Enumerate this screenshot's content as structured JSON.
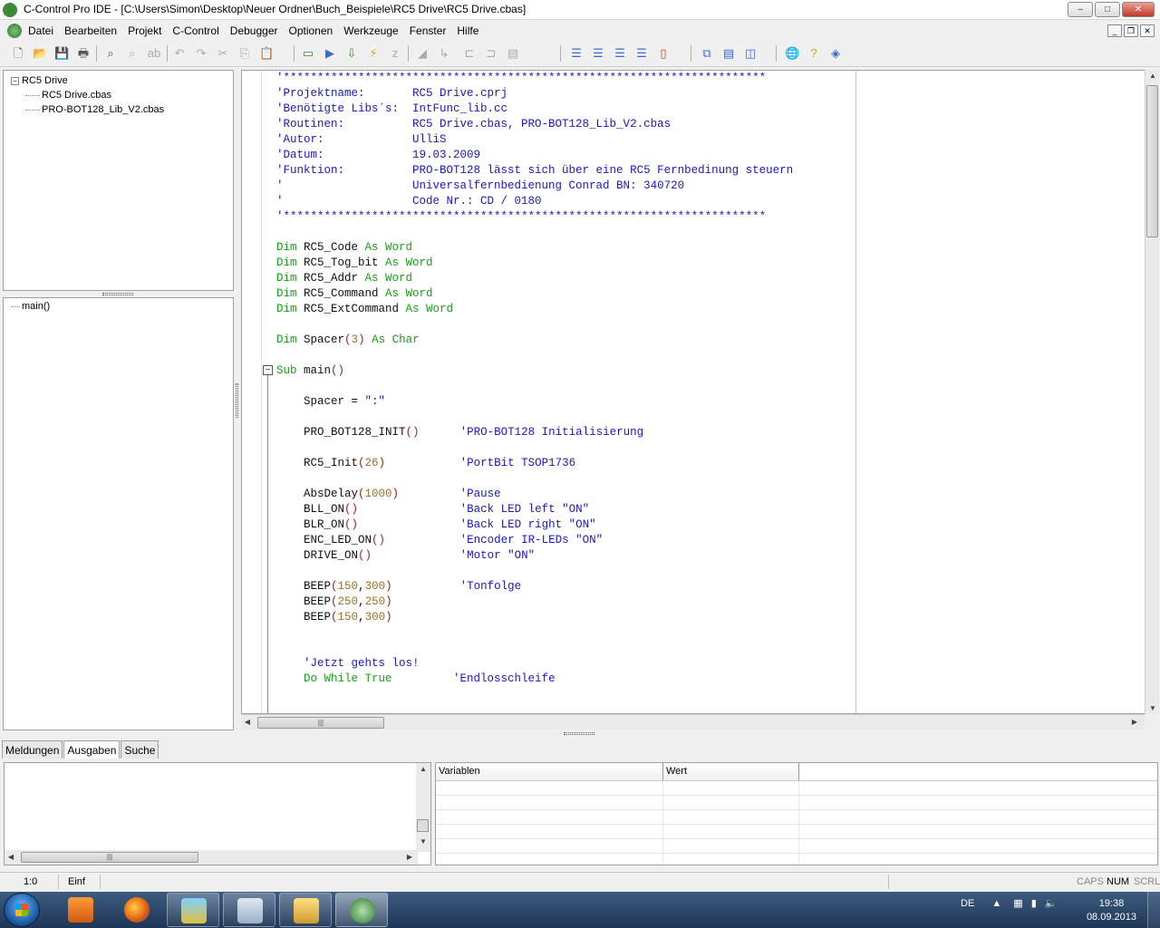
{
  "window": {
    "title": "C-Control Pro IDE - [C:\\Users\\Simon\\Desktop\\Neuer Ordner\\Buch_Beispiele\\RC5 Drive\\RC5 Drive.cbas]",
    "minimize": "–",
    "maximize": "□",
    "close": "✕"
  },
  "menu": {
    "items": [
      "Datei",
      "Bearbeiten",
      "Projekt",
      "C-Control",
      "Debugger",
      "Optionen",
      "Werkzeuge",
      "Fenster",
      "Hilfe"
    ],
    "mdi_minimize": "_",
    "mdi_restore": "❐",
    "mdi_close": "✕"
  },
  "project_tree": {
    "root": "RC5 Drive",
    "toggle": "−",
    "files": [
      "RC5 Drive.cbas",
      "PRO-BOT128_Lib_V2.cbas"
    ]
  },
  "functions": [
    "main()"
  ],
  "editor": {
    "lines": [
      [
        [
          "c-cm",
          "'***********************************************************************"
        ]
      ],
      [
        [
          "c-cm",
          "'Projektname:       RC5 Drive.cprj"
        ]
      ],
      [
        [
          "c-cm",
          "'Benötigte Libs´s:  IntFunc_lib.cc"
        ]
      ],
      [
        [
          "c-cm",
          "'Routinen:          RC5 Drive.cbas, PRO-BOT128_Lib_V2.cbas"
        ]
      ],
      [
        [
          "c-cm",
          "'Autor:             UlliS"
        ]
      ],
      [
        [
          "c-cm",
          "'Datum:             19.03.2009"
        ]
      ],
      [
        [
          "c-cm",
          "'Funktion:          PRO-BOT128 lässt sich über eine RC5 Fernbedinung steuern"
        ]
      ],
      [
        [
          "c-cm",
          "'                   Universalfernbedienung Conrad BN: 340720"
        ]
      ],
      [
        [
          "c-cm",
          "'                   Code Nr.: CD / 0180"
        ]
      ],
      [
        [
          "c-cm",
          "'***********************************************************************"
        ]
      ],
      [],
      [
        [
          "c-kw",
          "Dim "
        ],
        [
          "c-id",
          "RC5_Code "
        ],
        [
          "c-kw",
          "As Word"
        ]
      ],
      [
        [
          "c-kw",
          "Dim "
        ],
        [
          "c-id",
          "RC5_Tog_bit "
        ],
        [
          "c-kw",
          "As Word"
        ]
      ],
      [
        [
          "c-kw",
          "Dim "
        ],
        [
          "c-id",
          "RC5_Addr "
        ],
        [
          "c-kw",
          "As Word"
        ]
      ],
      [
        [
          "c-kw",
          "Dim "
        ],
        [
          "c-id",
          "RC5_Command "
        ],
        [
          "c-kw",
          "As Word"
        ]
      ],
      [
        [
          "c-kw",
          "Dim "
        ],
        [
          "c-id",
          "RC5_ExtCommand "
        ],
        [
          "c-kw",
          "As Word"
        ]
      ],
      [],
      [
        [
          "c-kw",
          "Dim "
        ],
        [
          "c-id",
          "Spacer"
        ],
        [
          "c-par",
          "("
        ],
        [
          "c-num",
          "3"
        ],
        [
          "c-par",
          ")"
        ],
        [
          "c-kw",
          " As Char"
        ]
      ],
      [],
      [
        [
          "c-kw",
          "Sub "
        ],
        [
          "c-id",
          "main"
        ],
        [
          "c-par",
          "()"
        ]
      ],
      [],
      [
        [
          "c-id",
          "    Spacer = "
        ],
        [
          "c-str",
          "\":\""
        ]
      ],
      [],
      [
        [
          "c-id",
          "    PRO_BOT128_INIT"
        ],
        [
          "c-par",
          "()"
        ],
        [
          "c-id",
          "      "
        ],
        [
          "c-cm",
          "'PRO-BOT128 Initialisierung"
        ]
      ],
      [],
      [
        [
          "c-id",
          "    RC5_Init"
        ],
        [
          "c-par",
          "("
        ],
        [
          "c-num",
          "26"
        ],
        [
          "c-par",
          ")"
        ],
        [
          "c-id",
          "           "
        ],
        [
          "c-cm",
          "'PortBit TSOP1736"
        ]
      ],
      [],
      [
        [
          "c-id",
          "    AbsDelay"
        ],
        [
          "c-par",
          "("
        ],
        [
          "c-num",
          "1000"
        ],
        [
          "c-par",
          ")"
        ],
        [
          "c-id",
          "         "
        ],
        [
          "c-cm",
          "'Pause"
        ]
      ],
      [
        [
          "c-id",
          "    BLL_ON"
        ],
        [
          "c-par",
          "()"
        ],
        [
          "c-id",
          "               "
        ],
        [
          "c-cm",
          "'Back LED left \"ON\""
        ]
      ],
      [
        [
          "c-id",
          "    BLR_ON"
        ],
        [
          "c-par",
          "()"
        ],
        [
          "c-id",
          "               "
        ],
        [
          "c-cm",
          "'Back LED right \"ON\""
        ]
      ],
      [
        [
          "c-id",
          "    ENC_LED_ON"
        ],
        [
          "c-par",
          "()"
        ],
        [
          "c-id",
          "           "
        ],
        [
          "c-cm",
          "'Encoder IR-LEDs \"ON\""
        ]
      ],
      [
        [
          "c-id",
          "    DRIVE_ON"
        ],
        [
          "c-par",
          "()"
        ],
        [
          "c-id",
          "             "
        ],
        [
          "c-cm",
          "'Motor \"ON\""
        ]
      ],
      [],
      [
        [
          "c-id",
          "    BEEP"
        ],
        [
          "c-par",
          "("
        ],
        [
          "c-num",
          "150"
        ],
        [
          "c-id",
          ","
        ],
        [
          "c-num",
          "300"
        ],
        [
          "c-par",
          ")"
        ],
        [
          "c-id",
          "          "
        ],
        [
          "c-cm",
          "'Tonfolge"
        ]
      ],
      [
        [
          "c-id",
          "    BEEP"
        ],
        [
          "c-par",
          "("
        ],
        [
          "c-num",
          "250"
        ],
        [
          "c-id",
          ","
        ],
        [
          "c-num",
          "250"
        ],
        [
          "c-par",
          ")"
        ]
      ],
      [
        [
          "c-id",
          "    BEEP"
        ],
        [
          "c-par",
          "("
        ],
        [
          "c-num",
          "150"
        ],
        [
          "c-id",
          ","
        ],
        [
          "c-num",
          "300"
        ],
        [
          "c-par",
          ")"
        ]
      ],
      [],
      [],
      [
        [
          "c-cm",
          "    'Jetzt gehts los!"
        ]
      ],
      [
        [
          "c-kw",
          "    Do While True"
        ],
        [
          "c-id",
          "         "
        ],
        [
          "c-cm",
          "'Endlosschleife"
        ]
      ]
    ]
  },
  "bottom_tabs": [
    "Meldungen",
    "Ausgaben",
    "Suche"
  ],
  "active_bottom_tab": "Ausgaben",
  "variables_table": {
    "columns": [
      "Variablen",
      "Wert"
    ]
  },
  "statusbar": {
    "position": "1:0",
    "mode": "Einf",
    "caps": "CAPS",
    "num": "NUM",
    "scrl": "SCRL"
  },
  "taskbar": {
    "lang": "DE",
    "time": "19:38",
    "date": "08.09.2013"
  },
  "icons": {
    "app": "c-control-app-icon",
    "accent": "#3a8a3a"
  }
}
